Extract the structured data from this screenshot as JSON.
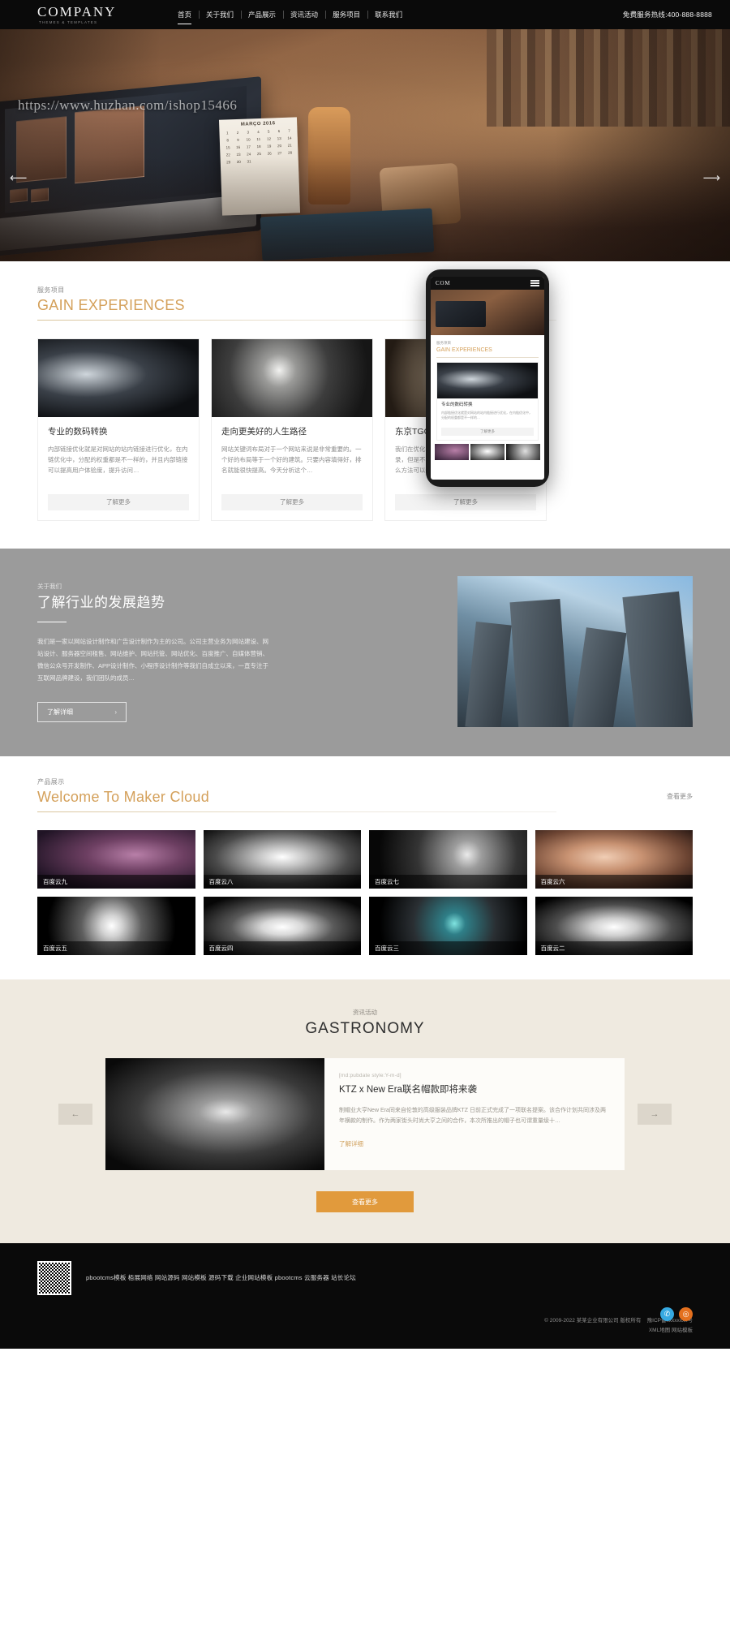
{
  "header": {
    "logo_main": "COMPANY",
    "logo_sub": "THEMES & TEMPLATES",
    "nav": [
      {
        "label": "首页",
        "active": true
      },
      {
        "label": "关于我们",
        "active": false
      },
      {
        "label": "产品展示",
        "active": false
      },
      {
        "label": "资讯活动",
        "active": false
      },
      {
        "label": "服务项目",
        "active": false
      },
      {
        "label": "联系我们",
        "active": false
      }
    ],
    "hotline": "免费服务热线:400-888-8888"
  },
  "hero": {
    "watermark_url": "https://www.huzhan.com/ishop15466",
    "prev_icon": "arrow-left-icon",
    "next_icon": "arrow-right-icon",
    "calendar_month": "MARÇO 2016",
    "calendar_days": [
      "1",
      "2",
      "3",
      "4",
      "5",
      "6",
      "7",
      "8",
      "9",
      "10",
      "11",
      "12",
      "13",
      "14",
      "15",
      "16",
      "17",
      "18",
      "19",
      "20",
      "21",
      "22",
      "23",
      "24",
      "25",
      "26",
      "27",
      "28",
      "29",
      "30",
      "31"
    ]
  },
  "services": {
    "kicker": "服务项目",
    "title": "GAIN EXPERIENCES",
    "cards": [
      {
        "title": "专业的数码转换",
        "desc": "内部链接优化就是对网站的站内链接进行优化，在内链优化中，分配的权重都是不一样的，并且内部链接可以提高用户体验度，提升访问…",
        "button": "了解更多"
      },
      {
        "title": "走向更美好的人生路径",
        "desc": "网站关键词布局对于一个网站来说是非常重要的。一个好的布局等于一个好的建筑。只要内容填得好，排名就能很快提高。今天分析这个…",
        "button": "了解更多"
      },
      {
        "title": "东京TGC上的合作秀",
        "desc": "我们在优化网站时，会发现网站页面被搜索引擎收录，但是不收录对于网站来说是非常不利的，那么什么方法可以快速…",
        "button": "了解更多"
      }
    ]
  },
  "about": {
    "kicker": "关于我们",
    "title": "了解行业的发展趋势",
    "desc": "我们是一家以网站设计制作和广告设计制作为主的公司。公司主营业务为网站建设、网站设计、服务器空间租售、网站维护、网站托管、网站优化、百度推广、自媒体营销、微信公众号开发制作、APP设计制作、小程序设计制作等我们自成立以来，一直专注于互联网品牌建设，我们团队的成员…",
    "button": "了解详细",
    "button_arrow": "›"
  },
  "products": {
    "kicker": "产品展示",
    "title": "Welcome To Maker Cloud",
    "more": "查看更多",
    "items": [
      {
        "label": "百度云九"
      },
      {
        "label": "百度云八"
      },
      {
        "label": "百度云七"
      },
      {
        "label": "百度云六"
      },
      {
        "label": "百度云五"
      },
      {
        "label": "百度云四"
      },
      {
        "label": "百度云三"
      },
      {
        "label": "百度云二"
      }
    ]
  },
  "news": {
    "kicker": "资讯活动",
    "title": "GASTRONOMY",
    "prev_icon": "arrow-left-icon",
    "next_icon": "arrow-right-icon",
    "prev_label": "←",
    "next_label": "→",
    "article": {
      "date": "[md:pubdate style:Y-m-d]",
      "title": "KTZ x New Era联名帽款即将来袭",
      "desc": "制帽业大亨New Era同来自伦敦的高级服装品牌KTZ 日前正式完成了一项联名提案。该合作计划共同涉及两年横款的制作。作为两家街头时尚大亨之间的合作，本次所推出的帽子也可谓重量级十…",
      "link": "了解详细"
    },
    "more_button": "查看更多"
  },
  "footer": {
    "qr_icon": "qr-code-icon",
    "links": "pbootcms模板 栢展网络 网站源码 网站模板 源码下载 企业网站模板 pbootcms 云服务器 站长论坛",
    "copyright": "© 2009-2022 某某企业有限公司 版权所有",
    "icp": "豫ICP备xxxxxxxx号",
    "sitemap": "XML地图 网站模板",
    "social": [
      {
        "name": "qq-icon",
        "glyph": "🐧"
      },
      {
        "name": "weibo-icon",
        "glyph": "⊚"
      }
    ]
  },
  "phone_mockup": {
    "logo": "COM",
    "menu_icon": "hamburger-icon",
    "kicker": "服务项目",
    "title": "GAIN EXPERIENCES",
    "card_title": "专业的数码转换",
    "card_desc": "内部链接优化就是对网站的站内链接进行优化，在内链优化中，分配的权重都是不一样的…",
    "card_button": "了解更多"
  },
  "colors": {
    "accent_gold": "#d4a05a",
    "accent_orange": "#e19a3c",
    "header_bg": "#0a0a0a",
    "about_bg": "#9b9b9b",
    "news_bg": "#efeae0"
  }
}
